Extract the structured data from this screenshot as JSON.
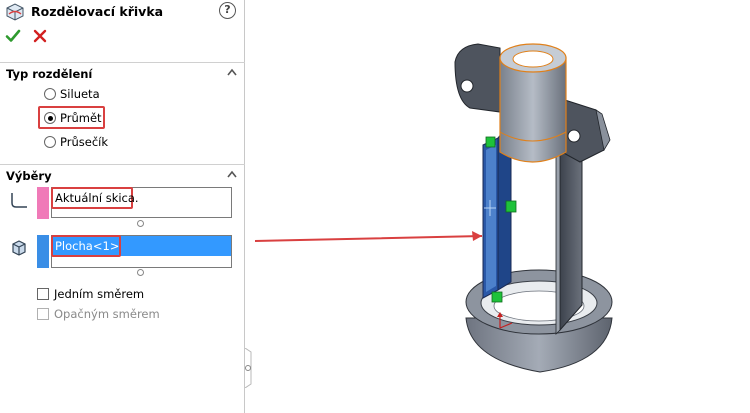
{
  "panel": {
    "title": "Rozdělovací křivka",
    "help": "?",
    "ok_icon": "checkmark-icon",
    "cancel_icon": "x-icon"
  },
  "split_type": {
    "header": "Typ rozdělení",
    "options": [
      {
        "label": "Silueta",
        "selected": false
      },
      {
        "label": "Průmět",
        "selected": true
      },
      {
        "label": "Průsečík",
        "selected": false
      }
    ]
  },
  "selections": {
    "header": "Výběry",
    "sketch_value": "Aktuální skica.",
    "face_value": "Plocha<1>",
    "single_direction_label": "Jedním směrem",
    "reverse_direction_label": "Opačným směrem"
  },
  "colors": {
    "highlight": "#d94040",
    "sketch_tab": "#f07ab8",
    "face_tab": "#3a8ee6",
    "selection": "#3399ff",
    "edge_orange": "#e0801a"
  }
}
